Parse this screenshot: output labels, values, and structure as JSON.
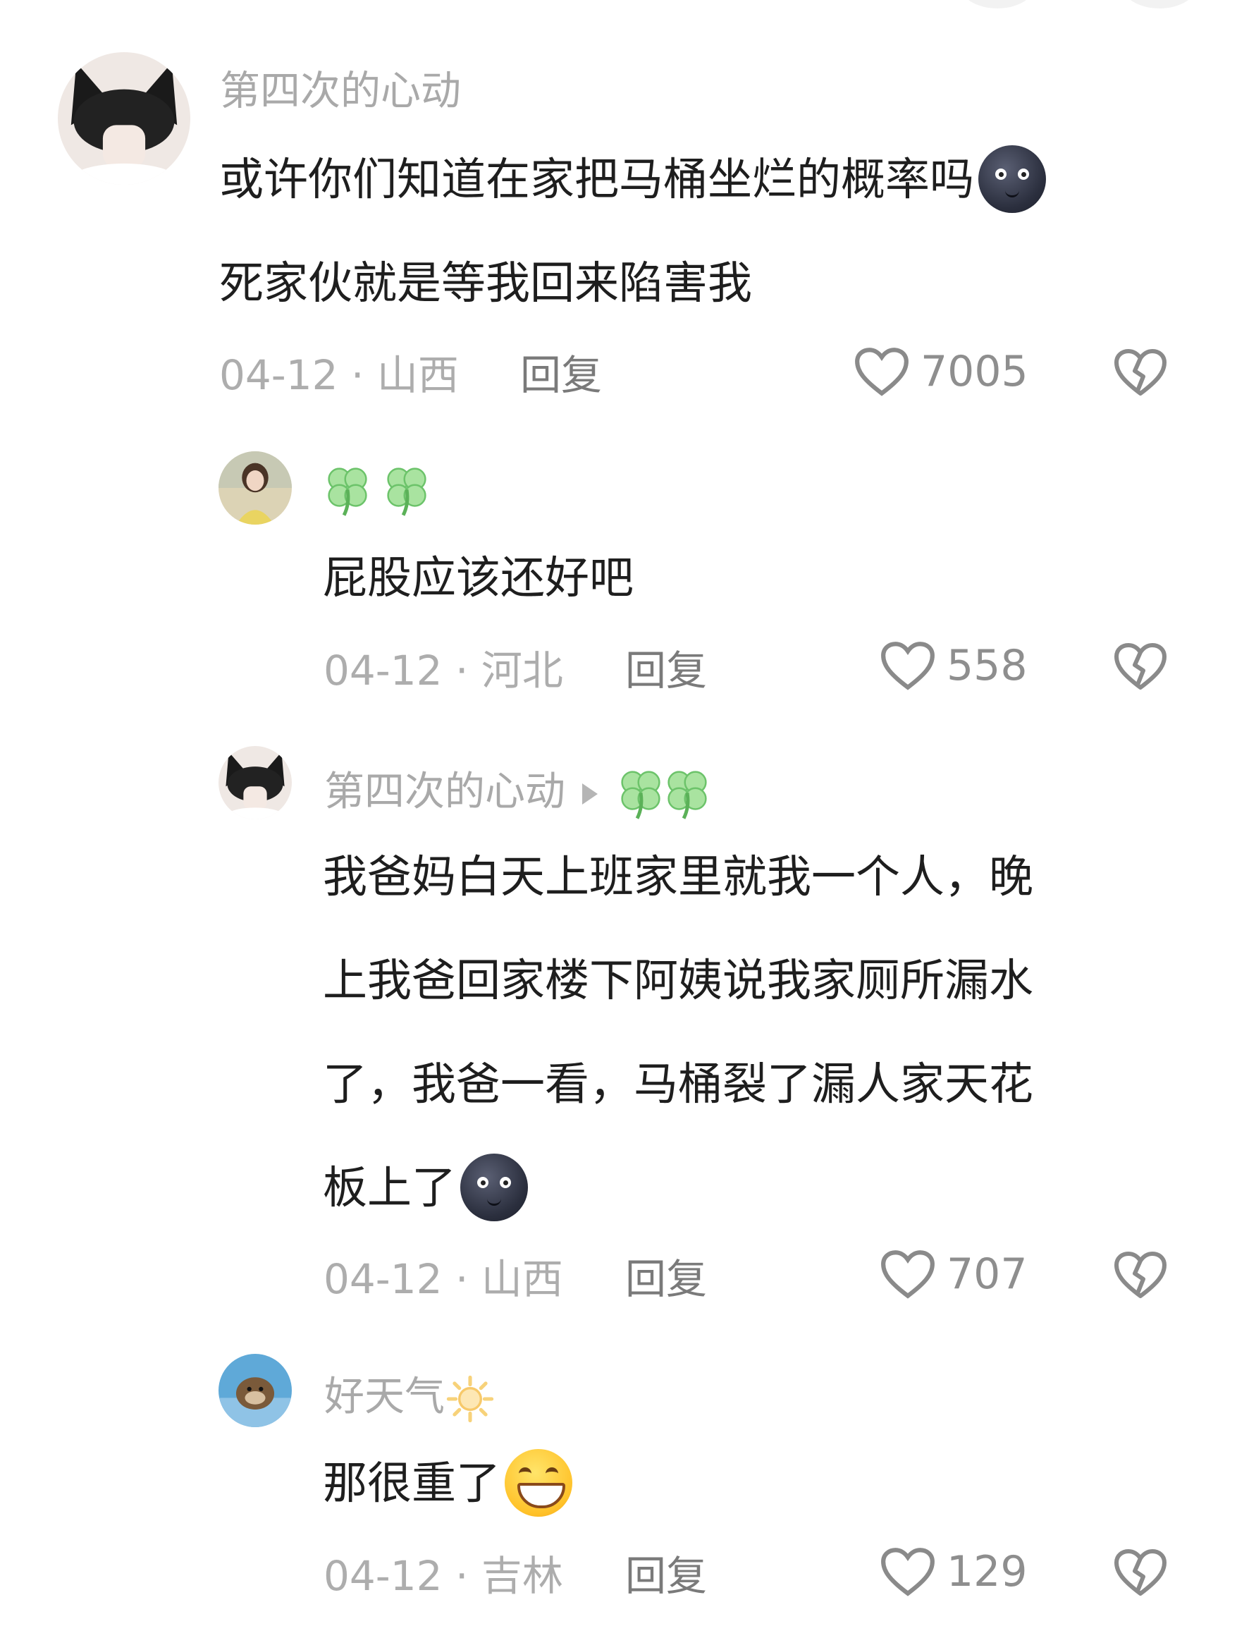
{
  "comments": [
    {
      "username": "第四次的心动",
      "lines": [
        "或许你们知道在家把马桶坐烂的概率吗",
        "死家伙就是等我回来陷害我"
      ],
      "date": "04-12",
      "location": "山西",
      "reply_label": "回复",
      "likes": "7005"
    },
    {
      "username": "",
      "username_icons": [
        "four-leaf-clover",
        "four-leaf-clover"
      ],
      "lines": [
        "屁股应该还好吧"
      ],
      "date": "04-12",
      "location": "河北",
      "reply_label": "回复",
      "likes": "558"
    },
    {
      "username": "第四次的心动",
      "reply_to_icons": [
        "four-leaf-clover",
        "four-leaf-clover"
      ],
      "lines": [
        "我爸妈白天上班家里就我一个人，晚",
        "上我爸回家楼下阿姨说我家厕所漏水",
        "了，我爸一看，马桶裂了漏人家天花",
        "板上了"
      ],
      "date": "04-12",
      "location": "山西",
      "reply_label": "回复",
      "likes": "707"
    },
    {
      "username": "好天气",
      "username_icons": [
        "sun"
      ],
      "lines": [
        "那很重了"
      ],
      "date": "04-12",
      "location": "吉林",
      "reply_label": "回复",
      "likes": "129"
    }
  ],
  "separator": " · ",
  "emojis": [
    "new-moon-face",
    "grinning-squinting-face"
  ],
  "colors": {
    "meta": "#adadad",
    "name": "#a9a9a9",
    "text": "#1e1e1e"
  }
}
